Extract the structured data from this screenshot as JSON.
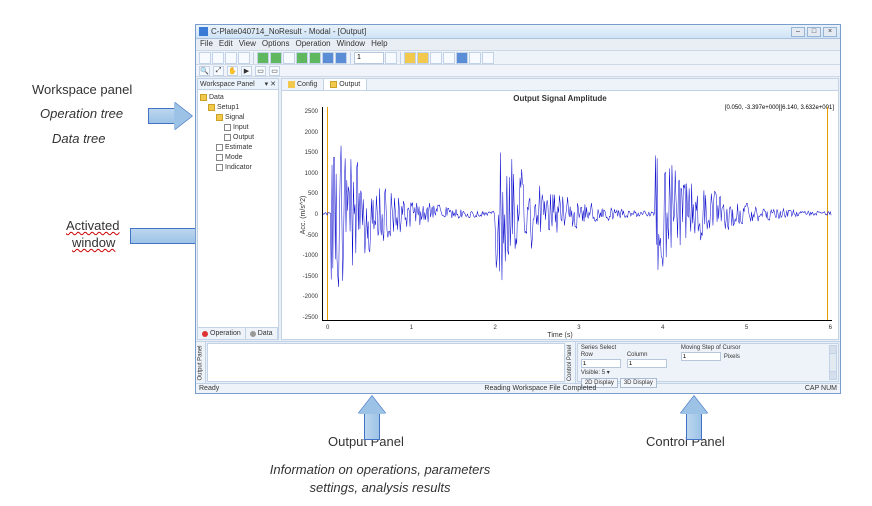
{
  "annotations": {
    "workspace_panel": "Workspace panel",
    "operation_tree": "Operation tree",
    "data_tree": "Data tree",
    "activated_window": "Activated",
    "activated_window2": "window",
    "output_panel": "Output Panel",
    "control_panel": "Control Panel",
    "info_line1": "Information on operations, parameters",
    "info_line2": "settings, analysis results"
  },
  "window": {
    "title": "C-Plate040714_NoResult - Modal - [Output]",
    "winbtns": {
      "min": "–",
      "max": "□",
      "close": "×"
    }
  },
  "menu": [
    "File",
    "Edit",
    "View",
    "Options",
    "Operation",
    "Window",
    "Help"
  ],
  "toolbar": {
    "input": "1"
  },
  "workspace": {
    "head": "Workspace Panel",
    "head_btn": "▾ ✕",
    "tree": {
      "root": "Data",
      "setup": "Setup1",
      "signal": "Signal",
      "input": "Input",
      "output": "Output",
      "estimate": "Estimate",
      "mode": "Mode",
      "indicator": "Indicator"
    },
    "tabs": {
      "operation": "Operation",
      "data": "Data"
    }
  },
  "main_tabs": {
    "config": "Config",
    "output": "Output"
  },
  "chart": {
    "title": "Output Signal Amplitude",
    "cursor_info": "[0.050, -3.397e+000][6.140, 3.632e+001]",
    "ylabel": "Acc. (m/s^2)",
    "xlabel": "Time (s)",
    "yticks": [
      "2500",
      "2000",
      "1500",
      "1000",
      "500",
      "0",
      "-500",
      "-1000",
      "-1500",
      "-2000",
      "-2500"
    ],
    "xticks": [
      "0",
      "1",
      "2",
      "3",
      "4",
      "5",
      "6"
    ]
  },
  "chart_data": {
    "type": "line",
    "title": "Output Signal Amplitude",
    "xlabel": "Time (s)",
    "ylabel": "Acc. (m/s^2)",
    "xlim": [
      0,
      6.2
    ],
    "ylim": [
      -2800,
      2800
    ],
    "series": [
      {
        "name": "output",
        "color": "#0000cc",
        "note": "three decaying transient bursts starting near t≈0.1s, t≈2.1s, t≈4.05s; each burst initial peak amplitude ≈ ±2500 decaying to ≈ ±150 over ~1.8s"
      }
    ],
    "cursors": [
      {
        "x": 0.05,
        "y": -3.397,
        "color": "#e69b00"
      },
      {
        "x": 6.14,
        "y": 36.32,
        "color": "#e69b00"
      }
    ]
  },
  "control": {
    "series_select": "Series Select",
    "row": "Row",
    "row_val": "1",
    "column": "Column",
    "col_val": "1",
    "visible": "Visible: 5 ▾",
    "moving": "Moving Step of Cursor",
    "moving_val": "1",
    "pixels": "Pixels",
    "btn2d": "2D Display",
    "btn3d": "3D Display"
  },
  "status": {
    "left": "Ready",
    "mid": "Reading Workspace File Completed",
    "right": "CAP  NUM"
  },
  "panels": {
    "output": "Output Panel",
    "control": "Control Panel"
  }
}
